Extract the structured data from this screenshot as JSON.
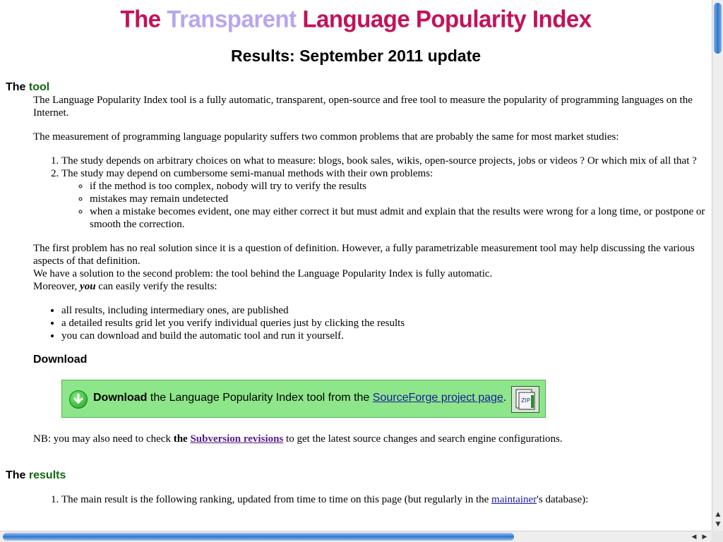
{
  "title": {
    "the": "The",
    "transparent": "Transparent",
    "rest": "Language Popularity Index"
  },
  "subtitle": "Results: September 2011 update",
  "tool_section": {
    "the": "The",
    "word": "tool",
    "intro": "The Language Popularity Index tool is a fully automatic, transparent, open-source and free tool to measure the popularity of programming languages on the Internet.",
    "problems_intro": "The measurement of programming language popularity suffers two common problems that are probably the same for most market studies:",
    "problem_1": "The study depends on arbitrary choices on what to measure: blogs, book sales, wikis, open-source projects, jobs or videos ? Or which mix of all that ?",
    "problem_2": "The study may depend on cumbersome semi-manual methods with their own problems:",
    "sub_problems": [
      "if the method is too complex, nobody will try to verify the results",
      "mistakes may remain undetected",
      "when a mistake becomes evident, one may either correct it but must admit and explain that the results were wrong for a long time, or postpone or smooth the correction."
    ],
    "first_problem": "The first problem has no real solution since it is a question of definition. However, a fully parametrizable measurement tool may help discussing the various aspects of that definition.",
    "second_problem": "We have a solution to the second problem: the tool behind the Language Popularity Index is fully automatic.",
    "moreover": "Moreover,",
    "you": "you",
    "verify": "can easily verify the results:",
    "bullets": [
      "all results, including intermediary ones, are published",
      "a detailed results grid let you verify individual queries just by clicking the results",
      "you can download and build the automatic tool and run it yourself."
    ]
  },
  "download": {
    "heading": "Download",
    "bold": "Download",
    "text": "the Language Popularity Index tool from the",
    "link": "SourceForge project page",
    "end": ".",
    "zip_label": "ZIP"
  },
  "nb": {
    "prefix": "NB: you may also need to check",
    "the": "the",
    "link": "Subversion revisions",
    "suffix": "to get the latest source changes and search engine configurations."
  },
  "results_section": {
    "the": "The",
    "word": "results",
    "item_1_prefix": "The main result is the following ranking, updated from time to time on this page (but regularly in the",
    "item_1_link": "maintainer",
    "item_1_suffix": "'s database):"
  },
  "colors": {
    "title_magenta": "#c4125a",
    "title_light": "#b7a7ee",
    "section_green": "#116611",
    "download_bg": "#8ee68a"
  }
}
